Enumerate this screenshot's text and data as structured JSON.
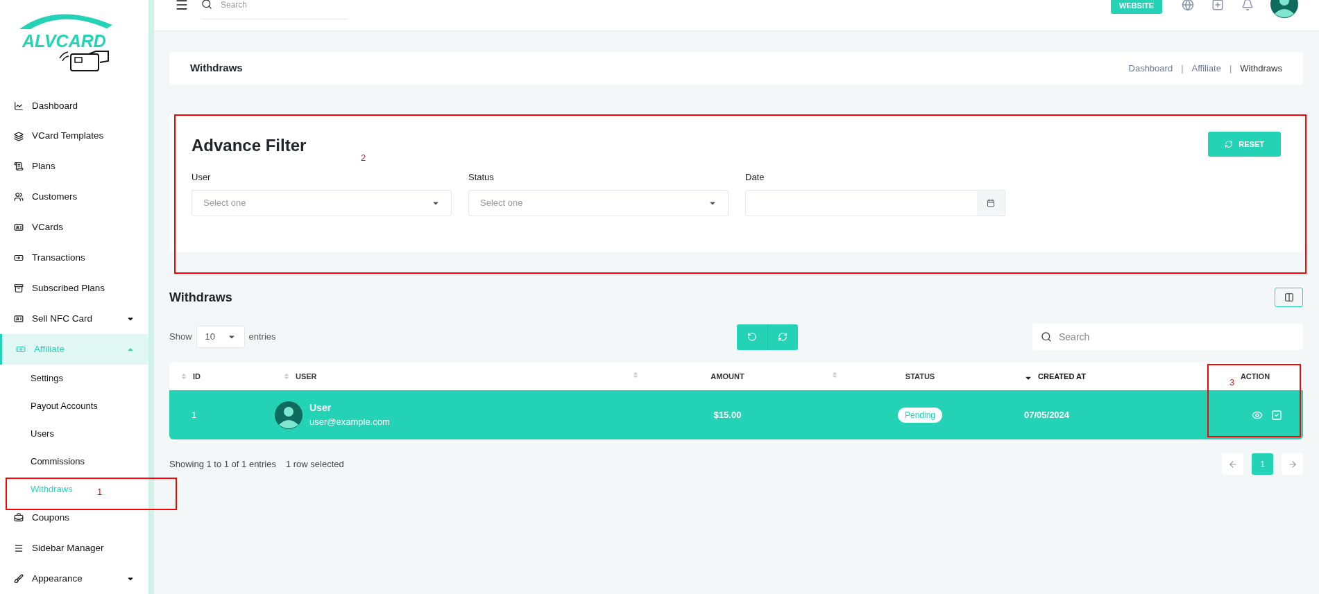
{
  "logo": {
    "text": "ALVCARD"
  },
  "sidebar": {
    "items": [
      {
        "label": "Dashboard",
        "selected": false
      },
      {
        "label": "VCard Templates",
        "selected": false
      },
      {
        "label": "Plans",
        "selected": false
      },
      {
        "label": "Customers",
        "selected": false
      },
      {
        "label": "VCards",
        "selected": false
      },
      {
        "label": "Transactions",
        "selected": false
      },
      {
        "label": "Subscribed Plans",
        "selected": false
      },
      {
        "label": "Sell NFC Card",
        "selected": false,
        "expanded": false
      },
      {
        "label": "Affiliate",
        "selected": true,
        "expanded": true,
        "children": [
          {
            "label": "Settings",
            "selected": false
          },
          {
            "label": "Payout Accounts",
            "selected": false
          },
          {
            "label": "Users",
            "selected": false
          },
          {
            "label": "Commissions",
            "selected": false
          },
          {
            "label": "Withdraws",
            "selected": true
          }
        ]
      },
      {
        "label": "Coupons",
        "selected": false
      },
      {
        "label": "Sidebar Manager",
        "selected": false
      },
      {
        "label": "Appearance",
        "selected": false,
        "expanded": false
      }
    ]
  },
  "topbar": {
    "search_placeholder": "Search",
    "website_button": "WEBSITE"
  },
  "page_header": {
    "title": "Withdraws",
    "breadcrumbs": [
      "Dashboard",
      "Affiliate",
      "Withdraws"
    ],
    "separator": "|"
  },
  "filter": {
    "title": "Advance Filter",
    "reset_button": "RESET",
    "fields": [
      {
        "kind": "select",
        "label": "User",
        "placeholder": "Select one"
      },
      {
        "kind": "select",
        "label": "Status",
        "placeholder": "Select one"
      },
      {
        "kind": "date",
        "label": "Date"
      }
    ]
  },
  "table_section": {
    "title": "Withdraws",
    "show_label": "Show",
    "page_size": "10",
    "entries_label": "entries",
    "search_placeholder": "Search",
    "columns": [
      {
        "label": "ID",
        "sortable": true,
        "sorted": false
      },
      {
        "label": "USER",
        "sortable": true,
        "sorted": false
      },
      {
        "label": "AMOUNT",
        "sortable": true,
        "sorted": false
      },
      {
        "label": "STATUS",
        "sortable": true,
        "sorted": false
      },
      {
        "label": "CREATED AT",
        "sortable": true,
        "sorted": true
      },
      {
        "label": "ACTION",
        "sortable": false,
        "sorted": false
      }
    ],
    "rows": [
      {
        "selected": true,
        "id": "1",
        "user_name": "User",
        "user_email": "user@example.com",
        "amount": "$15.00",
        "status": "Pending",
        "created_at": "07/05/2024"
      }
    ],
    "summary": "Showing 1 to 1 of 1 entries",
    "selection_info": "1 row selected",
    "pages": [
      {
        "label": "1",
        "selected": true
      }
    ]
  },
  "annotations": [
    {
      "label": "1"
    },
    {
      "label": "2"
    },
    {
      "label": "3"
    }
  ]
}
